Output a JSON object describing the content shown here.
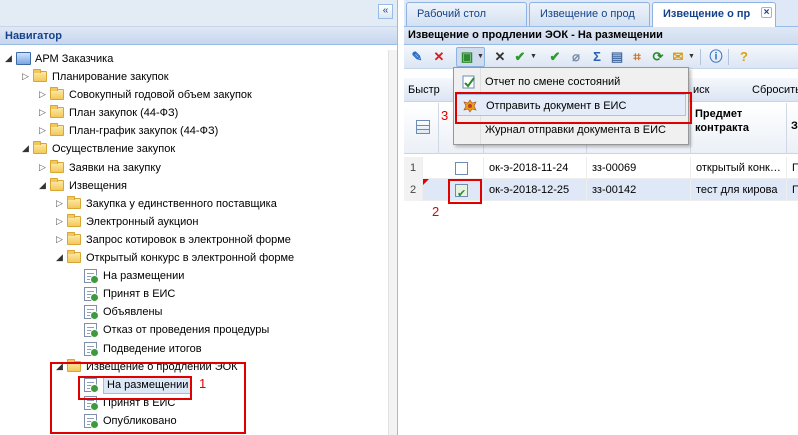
{
  "navigator": {
    "title": "Навигатор",
    "collapse_glyph": "«",
    "tree": [
      {
        "label": "АРМ Заказчика",
        "level": 0,
        "icon": "root-icon",
        "arrow": "expanded"
      },
      {
        "label": "Планирование закупок",
        "level": 1,
        "icon": "folder-icon",
        "arrow": "collapsed"
      },
      {
        "label": "Совокупный годовой объем закупок",
        "level": 2,
        "icon": "folder-icon",
        "arrow": "collapsed"
      },
      {
        "label": "План закупок (44-ФЗ)",
        "level": 2,
        "icon": "folder-icon",
        "arrow": "collapsed"
      },
      {
        "label": "План-график закупок (44-ФЗ)",
        "level": 2,
        "icon": "folder-icon",
        "arrow": "collapsed"
      },
      {
        "label": "Осуществление закупок",
        "level": 1,
        "icon": "folder-icon",
        "arrow": "expanded"
      },
      {
        "label": "Заявки на закупку",
        "level": 2,
        "icon": "folder-icon",
        "arrow": "collapsed"
      },
      {
        "label": "Извещения",
        "level": 2,
        "icon": "folder-icon",
        "arrow": "expanded"
      },
      {
        "label": "Закупка у единственного поставщика",
        "level": 3,
        "icon": "folder-icon",
        "arrow": "collapsed"
      },
      {
        "label": "Электронный аукцион",
        "level": 3,
        "icon": "folder-icon",
        "arrow": "collapsed"
      },
      {
        "label": "Запрос котировок в электронной форме",
        "level": 3,
        "icon": "folder-icon",
        "arrow": "collapsed"
      },
      {
        "label": "Открытый конкурс в электронной форме",
        "level": 3,
        "icon": "folder-icon",
        "arrow": "expanded"
      },
      {
        "label": "На размещении",
        "level": 4,
        "icon": "document-icon",
        "arrow": "none"
      },
      {
        "label": "Принят в ЕИС",
        "level": 4,
        "icon": "document-icon",
        "arrow": "none"
      },
      {
        "label": "Объявлены",
        "level": 4,
        "icon": "document-icon",
        "arrow": "none"
      },
      {
        "label": "Отказ от проведения процедуры",
        "level": 4,
        "icon": "document-icon",
        "arrow": "none"
      },
      {
        "label": "Подведение итогов",
        "level": 4,
        "icon": "document-icon",
        "arrow": "none"
      },
      {
        "label": "Извещение о продлении ЭОК",
        "level": 3,
        "icon": "folder-icon",
        "arrow": "expanded"
      },
      {
        "label": "На размещении",
        "level": 4,
        "icon": "document-icon",
        "arrow": "none",
        "selected": true
      },
      {
        "label": "Принят в ЕИС",
        "level": 4,
        "icon": "document-icon",
        "arrow": "none"
      },
      {
        "label": "Опубликовано",
        "level": 4,
        "icon": "document-icon",
        "arrow": "none"
      }
    ]
  },
  "tabs": [
    {
      "label": "Рабочий стол",
      "active": false
    },
    {
      "label": "Извещение о прод",
      "active": false
    },
    {
      "label": "Извещение о пр",
      "active": true,
      "close": "×"
    }
  ],
  "panel": {
    "title": "Извещение о продлении ЭОК - На размещении"
  },
  "toolbar": {
    "icons": [
      "edit-icon",
      "delete-icon",
      "export-icon",
      "close-icon",
      "check-icon",
      "sign-icon",
      "attach-icon",
      "sum-icon",
      "print-icon",
      "filter-icon",
      "refresh-icon",
      "send-icon",
      "info-icon",
      "help-icon"
    ]
  },
  "toolbar2": {
    "quick_label": "Быстр",
    "search_label": "иск",
    "reset_label": "Сбросить"
  },
  "grid": {
    "headers": {
      "subject_line1": "Предмет",
      "subject_line2": "контракта",
      "next": "З"
    },
    "rows": [
      {
        "num": "1",
        "checked": false,
        "number": "ок-э-2018-11-24",
        "code": "зз-00069",
        "subject": "открытый конк…",
        "next": "П"
      },
      {
        "num": "2",
        "checked": true,
        "number": "ок-э-2018-12-25",
        "code": "зз-00142",
        "subject": "тест для кирова",
        "next": "П"
      }
    ]
  },
  "menu": {
    "items": [
      {
        "label": "Отчет по смене состояний",
        "icon": "report-icon"
      },
      {
        "label": "Отправить документ в ЕИС",
        "icon": "eagle-emblem-icon",
        "hover": true
      },
      {
        "label": "Журнал отправки документа в ЕИС",
        "icon": "none"
      }
    ]
  },
  "annotations": {
    "one": "1",
    "two": "2",
    "three": "3",
    "color": "#e00000"
  },
  "colors": {
    "header_blue": "#15428b",
    "panel_bg": "#dfe8f6",
    "border": "#99bbe8"
  }
}
